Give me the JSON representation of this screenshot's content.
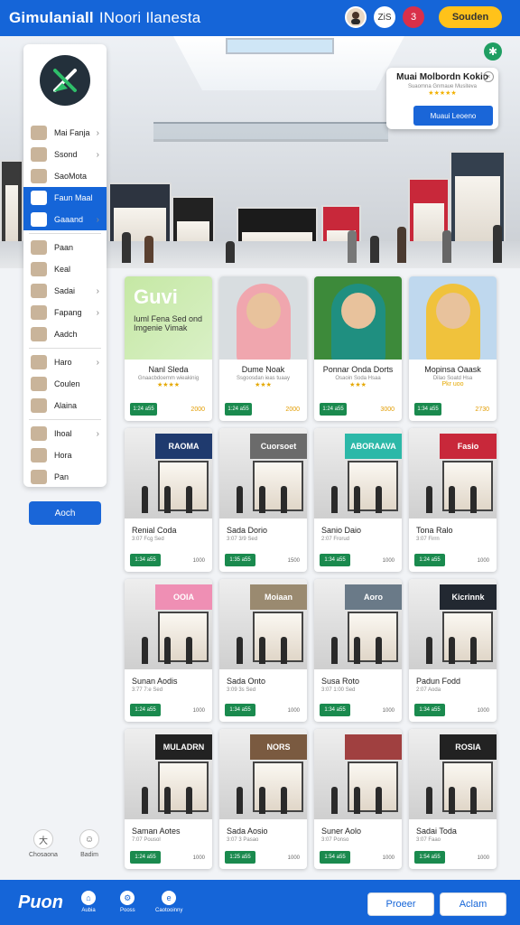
{
  "app": {
    "title": "Gimulaniall",
    "subtitle": "INoori Ilanesta"
  },
  "topbar": {
    "notif_count": "3",
    "profile_label": "ZiS",
    "action_label": "Souden"
  },
  "promo": {
    "title": "Muai Molbordn Kokio",
    "subtitle": "Suaomna Gnmaue Musiteva",
    "stars": "★★★★★",
    "button": "Muaui Leoeno"
  },
  "sidebar": {
    "items": [
      {
        "label": "Mai Fanja",
        "chev": "›"
      },
      {
        "label": "Ssond",
        "chev": "›"
      },
      {
        "label": "SaoMota",
        "chev": ""
      },
      {
        "label": "Faun Maal",
        "chev": ""
      },
      {
        "label": "Gaaand",
        "chev": "›"
      },
      {
        "label": "Paan",
        "chev": ""
      },
      {
        "label": "Keal",
        "chev": ""
      },
      {
        "label": "Sadai",
        "chev": "›"
      },
      {
        "label": "Fapang",
        "chev": "›"
      },
      {
        "label": "Aadch",
        "chev": ""
      },
      {
        "label": "Haro",
        "chev": "›"
      },
      {
        "label": "Coulen",
        "chev": ""
      },
      {
        "label": "Alaina",
        "chev": ""
      },
      {
        "label": "Ihoal",
        "chev": "›"
      },
      {
        "label": "Hora",
        "chev": ""
      },
      {
        "label": "Pan",
        "chev": ""
      }
    ],
    "button": "Aoch",
    "foot": [
      {
        "label": "Chosaona",
        "icon": "大"
      },
      {
        "label": "Badim",
        "icon": "☺"
      }
    ]
  },
  "cards_top": [
    {
      "name": "Nanl Sleda",
      "desc": "Gnaacbdoemm wieakinig",
      "stars": "★★★★",
      "tag": "1:24 a55",
      "price": "2000",
      "thumb_title": "Guvi",
      "thumb_sub": "Iuml Fena Sed ond Imgenie Vimak"
    },
    {
      "name": "Dume Noak",
      "desc": "Ssgoosdan ieas tuaay",
      "stars": "★★★",
      "tag": "1:24 a55",
      "price": "2000"
    },
    {
      "name": "Ponnar Onda Dorts",
      "desc": "Osaoin Soda Hsaa",
      "stars": "★★★",
      "tag": "1:24 a55",
      "price": "3000"
    },
    {
      "name": "Mopinsa Oaask",
      "desc": "Dilao Soatd Hsa",
      "stars": "Pkr uoo",
      "tag": "1:34 a55",
      "price": "2730"
    }
  ],
  "cards": [
    {
      "name": "Renial Coda",
      "desc": "3:07 Fcg Sed",
      "tag": "1:34 a55",
      "price": "1000",
      "sign": "RAOMA",
      "signbg": "#1f3a6e"
    },
    {
      "name": "Sada Dorio",
      "desc": "3:07 3/9 Sed",
      "tag": "1:35 a55",
      "price": "1500",
      "sign": "Cuorsoet",
      "signbg": "#6b6b6b"
    },
    {
      "name": "Sanio Daio",
      "desc": "2:07 Frorud",
      "tag": "1:34 a55",
      "price": "1000",
      "sign": "ABORAAVA",
      "signbg": "#2cb8a8"
    },
    {
      "name": "Tona Ralo",
      "desc": "3:07 Firrn",
      "tag": "1:24 a55",
      "price": "1000",
      "sign": "Fasio",
      "signbg": "#c8283a"
    },
    {
      "name": "Sunan Aodis",
      "desc": "3:77 7:e Sed",
      "tag": "1:24 a55",
      "price": "1000",
      "sign": "OOIA",
      "signbg": "#ef8fb4"
    },
    {
      "name": "Sada Onto",
      "desc": "3:09 3s Sed",
      "tag": "1:34 a55",
      "price": "1000",
      "sign": "Moiaan",
      "signbg": "#9a8a70"
    },
    {
      "name": "Susa Roto",
      "desc": "3:07 1:00 Sed",
      "tag": "1:34 a55",
      "price": "1000",
      "sign": "Aoro",
      "signbg": "#6a7a88"
    },
    {
      "name": "Padun Fodd",
      "desc": "2:07 Aoda",
      "tag": "1:34 a55",
      "price": "1000",
      "sign": "Kicrinnk",
      "signbg": "#222831"
    },
    {
      "name": "Saman Aotes",
      "desc": "7:07 Pousol",
      "tag": "1:24 a55",
      "price": "1000",
      "sign": "MULADRN",
      "signbg": "#222"
    },
    {
      "name": "Sada Aosio",
      "desc": "3:07 3 Pasao",
      "tag": "1:25 a55",
      "price": "1000",
      "sign": "NORS",
      "signbg": "#7a5a40"
    },
    {
      "name": "Suner Aolo",
      "desc": "3:07 Ponso",
      "tag": "1:54 a55",
      "price": "1000",
      "sign": "",
      "signbg": "#a04040"
    },
    {
      "name": "Sadai Toda",
      "desc": "3:07 Faao",
      "tag": "1:54 a55",
      "price": "1000",
      "sign": "ROSIA",
      "signbg": "#222"
    }
  ],
  "bottom": {
    "logo": "Puon",
    "items": [
      {
        "label": "Aubia",
        "icon": "⌂"
      },
      {
        "label": "Pooss",
        "icon": "⚙"
      },
      {
        "label": "Caotooinny",
        "icon": "e"
      }
    ],
    "btn1": "Proeer",
    "btn2": "Aclam"
  }
}
